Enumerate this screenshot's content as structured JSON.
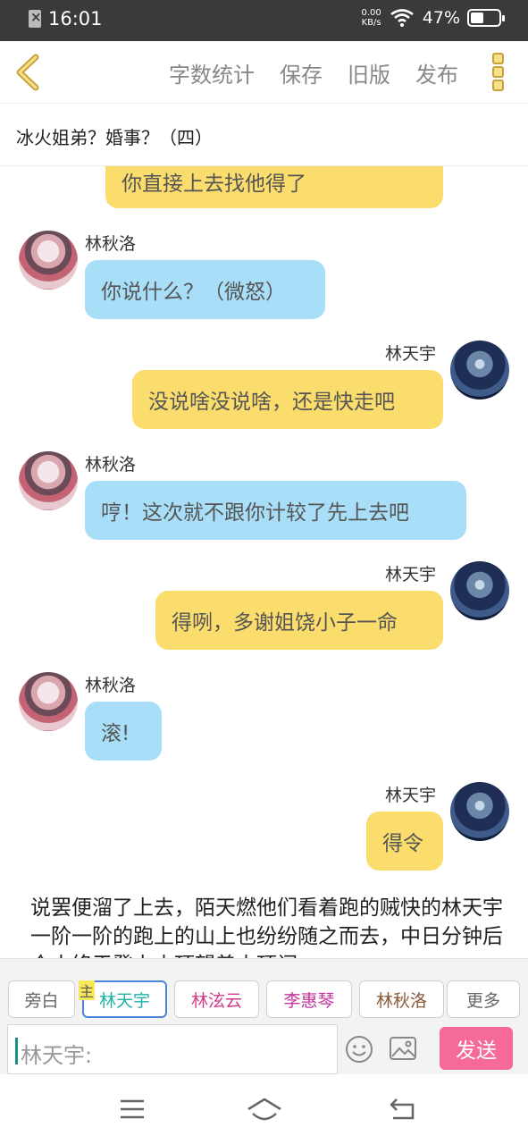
{
  "status_bar": {
    "time": "16:01",
    "net_speed_value": "0.00",
    "net_speed_unit": "KB/s",
    "battery_percent": "47%"
  },
  "toolbar": {
    "actions": [
      "字数统计",
      "保存",
      "旧版",
      "发布"
    ]
  },
  "document": {
    "title": "冰火姐弟？婚事？（四）"
  },
  "characters": {
    "left": "林秋洛",
    "right": "林天宇"
  },
  "messages": [
    {
      "side": "right",
      "text": "你直接上去找他得了"
    },
    {
      "side": "left",
      "name": "林秋洛",
      "text": "你说什么？（微怒）"
    },
    {
      "side": "right",
      "name": "林天宇",
      "text": "没说啥没说啥，还是快走吧"
    },
    {
      "side": "left",
      "name": "林秋洛",
      "text": "哼！这次就不跟你计较了先上去吧"
    },
    {
      "side": "right",
      "name": "林天宇",
      "text": "得咧，多谢姐饶小子一命"
    },
    {
      "side": "left",
      "name": "林秋洛",
      "text": "滚!"
    },
    {
      "side": "right",
      "name": "林天宇",
      "text": "得令"
    }
  ],
  "narration": "说罢便溜了上去，陌天燃他们看着跑的贼快的林天宇一阶一阶的跑上的山上也纷纷随之而去，中日分钟后众人终于登上山顶望着山顶闪",
  "roles": {
    "main_tag": "主",
    "chips": [
      {
        "label": "旁白",
        "color": "#666666"
      },
      {
        "label": "林天宇",
        "color": "#20b2a4"
      },
      {
        "label": "林泫云",
        "color": "#d23a8a"
      },
      {
        "label": "李惠琴",
        "color": "#c2359c"
      },
      {
        "label": "林秋洛",
        "color": "#8a5a3a"
      },
      {
        "label": "更多",
        "color": "#666666"
      }
    ]
  },
  "composer": {
    "placeholder": "林天宇:",
    "send_label": "发送"
  },
  "colors": {
    "right_bubble": "#fbdd6e",
    "left_bubble": "#a8def8",
    "send_button": "#f56a9a",
    "accent": "#c9a13a"
  }
}
